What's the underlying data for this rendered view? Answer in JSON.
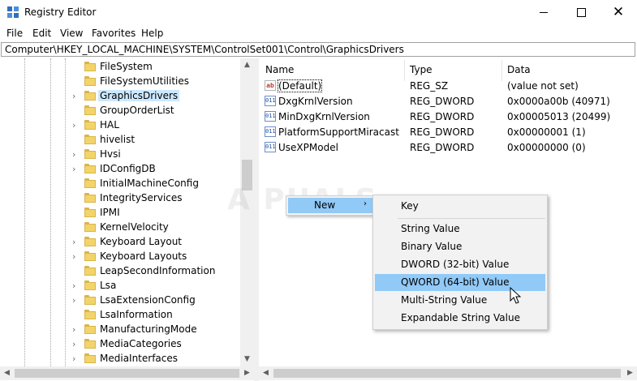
{
  "window": {
    "title": "Registry Editor",
    "icon": "registry-editor-icon",
    "controls": [
      "minimize-icon",
      "maximize-icon",
      "close-icon"
    ],
    "close_glyph": "✕"
  },
  "menu": [
    "File",
    "Edit",
    "View",
    "Favorites",
    "Help"
  ],
  "address": "Computer\\HKEY_LOCAL_MACHINE\\SYSTEM\\ControlSet001\\Control\\GraphicsDrivers",
  "tree": {
    "items": [
      {
        "label": "FileSystem",
        "expandable": false,
        "selected": false
      },
      {
        "label": "FileSystemUtilities",
        "expandable": false,
        "selected": false
      },
      {
        "label": "GraphicsDrivers",
        "expandable": true,
        "selected": true
      },
      {
        "label": "GroupOrderList",
        "expandable": false,
        "selected": false
      },
      {
        "label": "HAL",
        "expandable": true,
        "selected": false
      },
      {
        "label": "hivelist",
        "expandable": false,
        "selected": false
      },
      {
        "label": "Hvsi",
        "expandable": true,
        "selected": false
      },
      {
        "label": "IDConfigDB",
        "expandable": true,
        "selected": false
      },
      {
        "label": "InitialMachineConfig",
        "expandable": false,
        "selected": false
      },
      {
        "label": "IntegrityServices",
        "expandable": false,
        "selected": false
      },
      {
        "label": "IPMI",
        "expandable": false,
        "selected": false
      },
      {
        "label": "KernelVelocity",
        "expandable": false,
        "selected": false
      },
      {
        "label": "Keyboard Layout",
        "expandable": true,
        "selected": false
      },
      {
        "label": "Keyboard Layouts",
        "expandable": true,
        "selected": false
      },
      {
        "label": "LeapSecondInformation",
        "expandable": false,
        "selected": false
      },
      {
        "label": "Lsa",
        "expandable": true,
        "selected": false
      },
      {
        "label": "LsaExtensionConfig",
        "expandable": true,
        "selected": false
      },
      {
        "label": "LsaInformation",
        "expandable": false,
        "selected": false
      },
      {
        "label": "ManufacturingMode",
        "expandable": true,
        "selected": false
      },
      {
        "label": "MediaCategories",
        "expandable": true,
        "selected": false
      },
      {
        "label": "MediaInterfaces",
        "expandable": true,
        "selected": false
      }
    ]
  },
  "values_pane": {
    "headers": {
      "name": "Name",
      "type": "Type",
      "data": "Data"
    },
    "rows": [
      {
        "name": "(Default)",
        "type": "REG_SZ",
        "data": "(value not set)",
        "icon": "ab"
      },
      {
        "name": "DxgKrnlVersion",
        "type": "REG_DWORD",
        "data": "0x0000a00b (40971)",
        "icon": "011"
      },
      {
        "name": "MinDxgKrnlVersion",
        "type": "REG_DWORD",
        "data": "0x00005013 (20499)",
        "icon": "011"
      },
      {
        "name": "PlatformSupportMiracast",
        "type": "REG_DWORD",
        "data": "0x00000001 (1)",
        "icon": "011"
      },
      {
        "name": "UseXPModel",
        "type": "REG_DWORD",
        "data": "0x00000000 (0)",
        "icon": "011"
      }
    ]
  },
  "context_menu": {
    "new_label": "New",
    "new_arrow": "›",
    "submenu": {
      "key": "Key",
      "items": [
        "String Value",
        "Binary Value",
        "DWORD (32-bit) Value",
        "QWORD (64-bit) Value",
        "Multi-String Value",
        "Expandable String Value"
      ],
      "highlighted": "QWORD (64-bit) Value"
    }
  },
  "watermark": "A PUALS",
  "colors": {
    "selection": "#cce8ff",
    "menu_highlight": "#91c9f7",
    "folder": "#f2d46b"
  }
}
